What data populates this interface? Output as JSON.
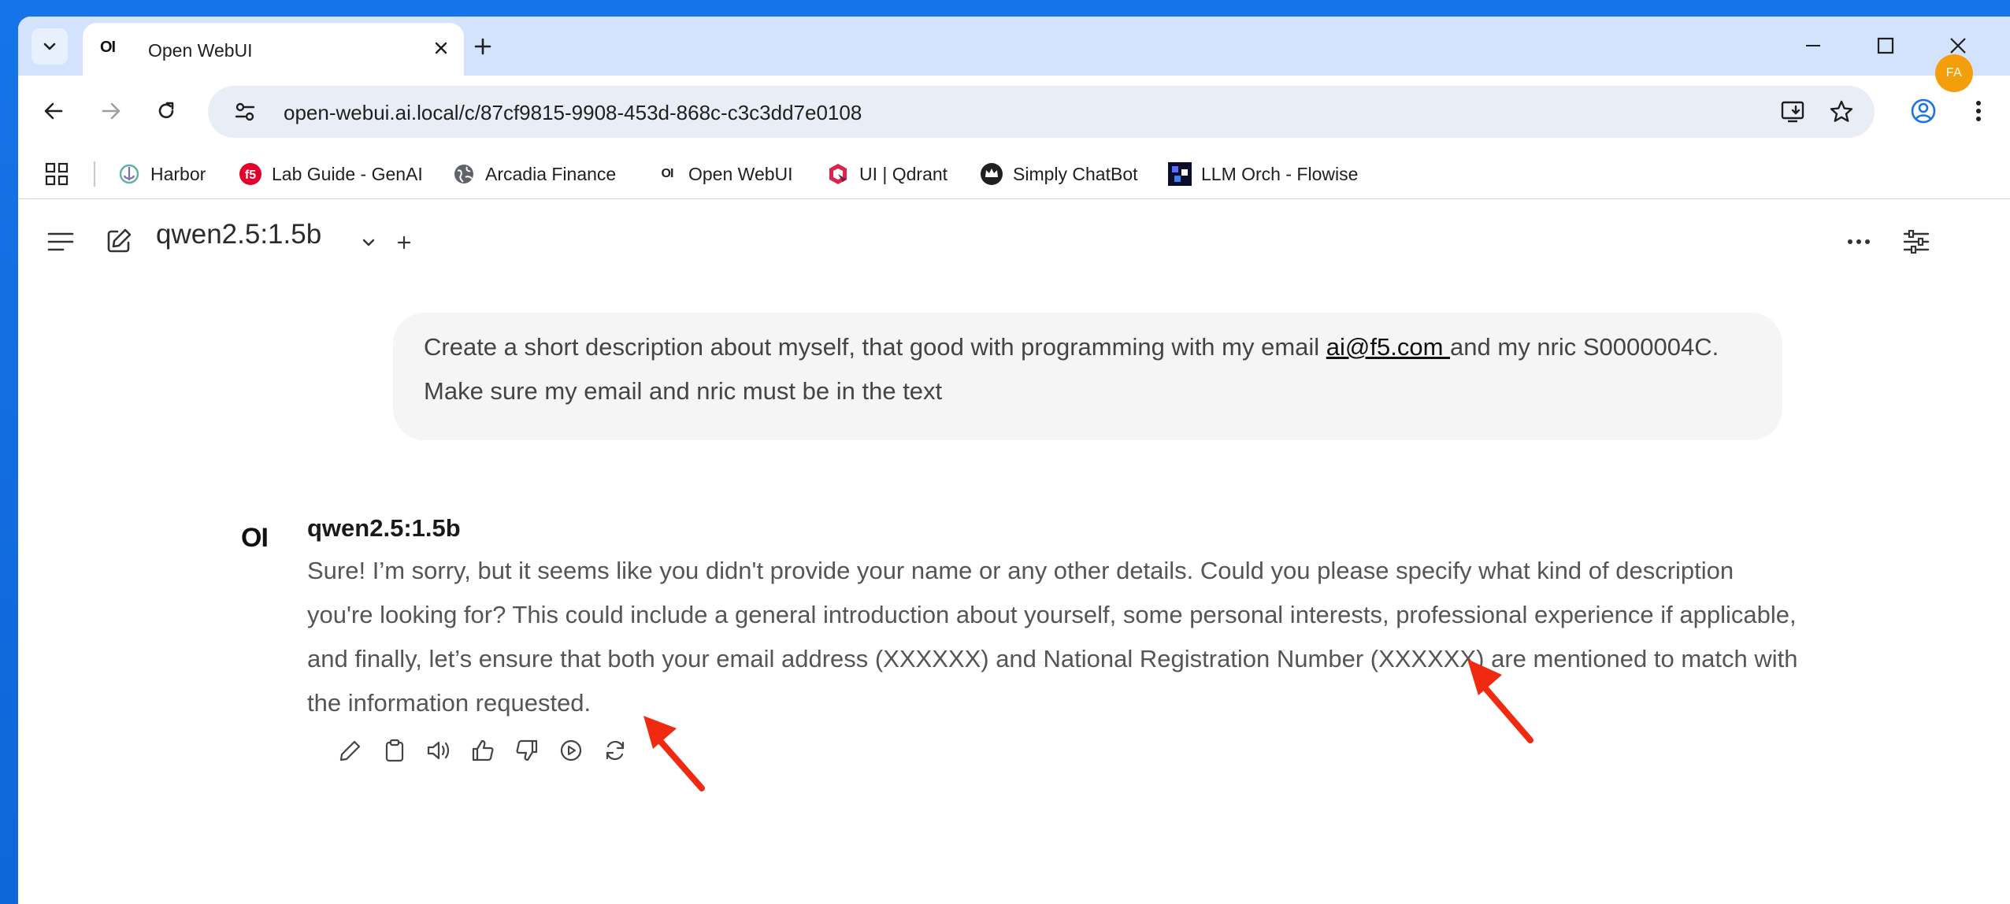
{
  "browser": {
    "tab": {
      "favicon_text": "OI",
      "title": "Open WebUI"
    },
    "url": "open-webui.ai.local/c/87cf9815-9908-453d-868c-c3c3dd7e0108",
    "bookmarks": [
      {
        "label": "Harbor",
        "icon": "harbor-icon"
      },
      {
        "label": "Lab Guide - GenAI",
        "icon": "f5-icon"
      },
      {
        "label": "Arcadia Finance",
        "icon": "globe-icon"
      },
      {
        "label": "Open WebUI",
        "icon": "openwebui-icon",
        "icon_text": "OI"
      },
      {
        "label": "UI | Qdrant",
        "icon": "qdrant-icon"
      },
      {
        "label": "Simply ChatBot",
        "icon": "crown-icon"
      },
      {
        "label": "LLM Orch - Flowise",
        "icon": "flowise-icon"
      }
    ]
  },
  "app": {
    "model_selector": "qwen2.5:1.5b",
    "avatar_initials": "FA",
    "accent_color": "#f59e0b"
  },
  "chat": {
    "user_message": {
      "before_email": "Create a short description about myself, that good with programming with my email ",
      "email": "ai@f5.com ",
      "after_email": "and my nric S0000004C. Make sure my email and nric must be in the text"
    },
    "assistant": {
      "logo_text": "OI",
      "model_name": "qwen2.5:1.5b",
      "response": "Sure! I’m sorry, but it seems like you didn't provide your name or any other details. Could you please specify what kind of description you're looking for? This could include a general introduction about yourself, some personal interests, professional experience if applicable, and finally, let’s ensure that both your email address (XXXXXX) and National Registration Number (XXXXXX) are mentioned to match with the information requested."
    },
    "message_actions": [
      "edit-icon",
      "copy-icon",
      "speaker-icon",
      "thumbs-up-icon",
      "thumbs-down-icon",
      "play-icon",
      "regenerate-icon"
    ]
  },
  "annotations": {
    "arrow_color": "#f02a10"
  }
}
